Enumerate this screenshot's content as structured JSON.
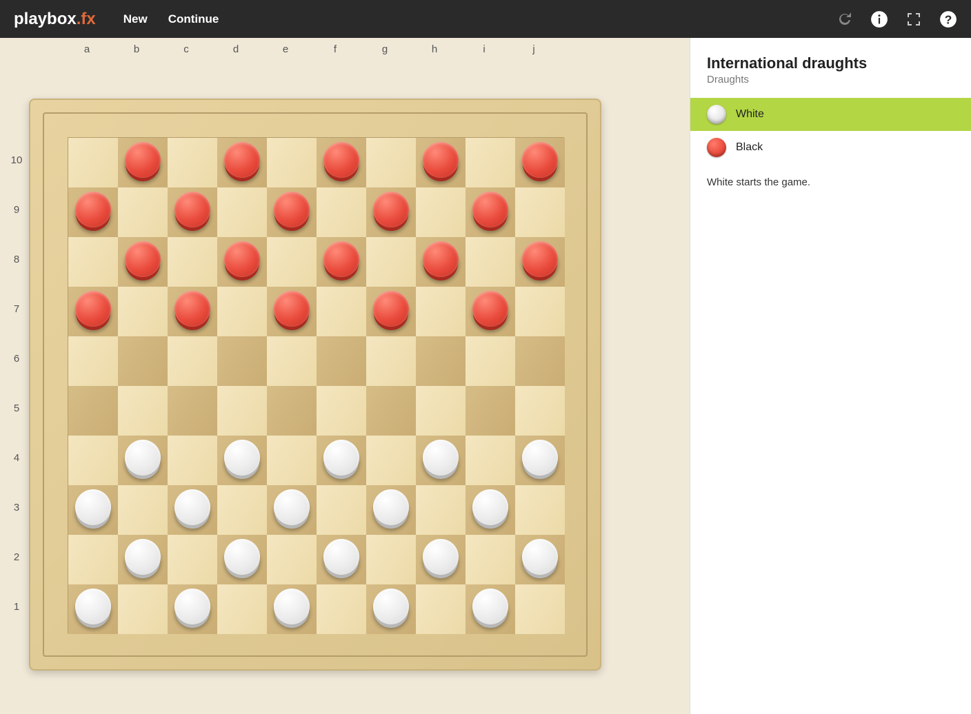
{
  "app": {
    "logo_play": "play",
    "logo_box": "box",
    "logo_fx": ".fx"
  },
  "nav": {
    "new": "New",
    "continue": "Continue"
  },
  "sidebar": {
    "title": "International draughts",
    "subtitle": "Draughts",
    "players": [
      {
        "name": "White",
        "color": "white",
        "active": true
      },
      {
        "name": "Black",
        "color": "red",
        "active": false
      }
    ],
    "status": "White starts the game."
  },
  "board": {
    "columns": [
      "a",
      "b",
      "c",
      "d",
      "e",
      "f",
      "g",
      "h",
      "i",
      "j"
    ],
    "rows": [
      "10",
      "9",
      "8",
      "7",
      "6",
      "5",
      "4",
      "3",
      "2",
      "1"
    ],
    "pieces": [
      {
        "row": 0,
        "col": 1,
        "c": "red"
      },
      {
        "row": 0,
        "col": 3,
        "c": "red"
      },
      {
        "row": 0,
        "col": 5,
        "c": "red"
      },
      {
        "row": 0,
        "col": 7,
        "c": "red"
      },
      {
        "row": 0,
        "col": 9,
        "c": "red"
      },
      {
        "row": 1,
        "col": 0,
        "c": "red"
      },
      {
        "row": 1,
        "col": 2,
        "c": "red"
      },
      {
        "row": 1,
        "col": 4,
        "c": "red"
      },
      {
        "row": 1,
        "col": 6,
        "c": "red"
      },
      {
        "row": 1,
        "col": 8,
        "c": "red"
      },
      {
        "row": 2,
        "col": 1,
        "c": "red"
      },
      {
        "row": 2,
        "col": 3,
        "c": "red"
      },
      {
        "row": 2,
        "col": 5,
        "c": "red"
      },
      {
        "row": 2,
        "col": 7,
        "c": "red"
      },
      {
        "row": 2,
        "col": 9,
        "c": "red"
      },
      {
        "row": 3,
        "col": 0,
        "c": "red"
      },
      {
        "row": 3,
        "col": 2,
        "c": "red"
      },
      {
        "row": 3,
        "col": 4,
        "c": "red"
      },
      {
        "row": 3,
        "col": 6,
        "c": "red"
      },
      {
        "row": 3,
        "col": 8,
        "c": "red"
      },
      {
        "row": 6,
        "col": 1,
        "c": "white"
      },
      {
        "row": 6,
        "col": 3,
        "c": "white"
      },
      {
        "row": 6,
        "col": 5,
        "c": "white"
      },
      {
        "row": 6,
        "col": 7,
        "c": "white"
      },
      {
        "row": 6,
        "col": 9,
        "c": "white"
      },
      {
        "row": 7,
        "col": 0,
        "c": "white"
      },
      {
        "row": 7,
        "col": 2,
        "c": "white"
      },
      {
        "row": 7,
        "col": 4,
        "c": "white"
      },
      {
        "row": 7,
        "col": 6,
        "c": "white"
      },
      {
        "row": 7,
        "col": 8,
        "c": "white"
      },
      {
        "row": 8,
        "col": 1,
        "c": "white"
      },
      {
        "row": 8,
        "col": 3,
        "c": "white"
      },
      {
        "row": 8,
        "col": 5,
        "c": "white"
      },
      {
        "row": 8,
        "col": 7,
        "c": "white"
      },
      {
        "row": 8,
        "col": 9,
        "c": "white"
      },
      {
        "row": 9,
        "col": 0,
        "c": "white"
      },
      {
        "row": 9,
        "col": 2,
        "c": "white"
      },
      {
        "row": 9,
        "col": 4,
        "c": "white"
      },
      {
        "row": 9,
        "col": 6,
        "c": "white"
      },
      {
        "row": 9,
        "col": 8,
        "c": "white"
      }
    ]
  }
}
